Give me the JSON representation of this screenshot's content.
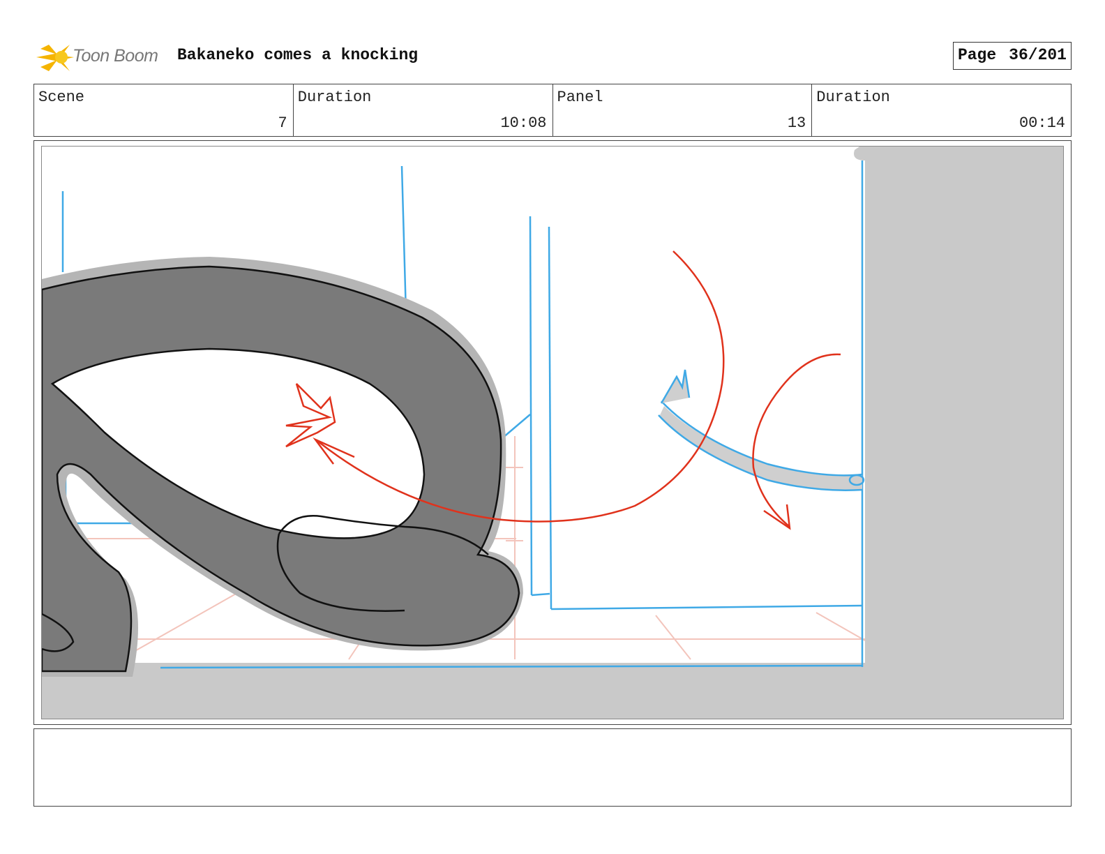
{
  "header": {
    "logo_text": "Toon Boom",
    "project_title": "Bakaneko comes a knocking",
    "page_label": "Page",
    "page_number": "36/201"
  },
  "info": {
    "scene_label": "Scene",
    "scene_value": "7",
    "scene_duration_label": "Duration",
    "scene_duration_value": "10:08",
    "panel_label": "Panel",
    "panel_value": "13",
    "panel_duration_label": "Duration",
    "panel_duration_value": "00:14"
  },
  "colors": {
    "cat_fill": "#7a7a7a",
    "cat_shadow": "#b5b5b5",
    "wall_gray": "#c9c9c9",
    "sketch_blue": "#3fa9e6",
    "action_red": "#e0321c",
    "perspective_pink": "#f3c4bb"
  }
}
